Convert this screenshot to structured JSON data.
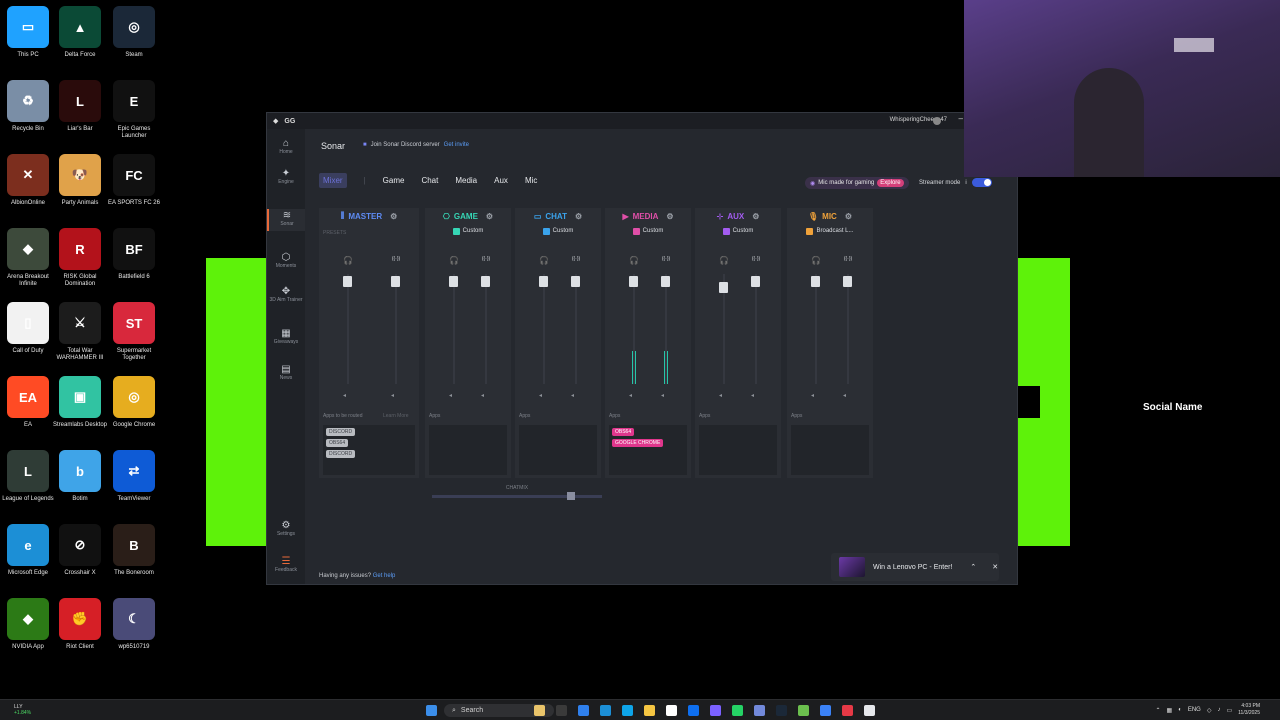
{
  "desktop": {
    "icons": [
      {
        "label": "This PC",
        "icon": "monitor-icon",
        "color": "#1fa2ff"
      },
      {
        "label": "Delta Force",
        "icon": "delta-force-icon",
        "color": "#0b4a36"
      },
      {
        "label": "Steam",
        "icon": "steam-icon",
        "color": "#1b2838"
      },
      {
        "label": "Recycle Bin",
        "icon": "recycle-bin-icon",
        "color": "#7a8ea6"
      },
      {
        "label": "Liar's Bar",
        "icon": "liars-bar-icon",
        "color": "#2a0b0b"
      },
      {
        "label": "Epic Games Launcher",
        "icon": "epic-games-icon",
        "color": "#111111"
      },
      {
        "label": "AlbionOnline",
        "icon": "albion-icon",
        "color": "#7c2e1e"
      },
      {
        "label": "Party Animals",
        "icon": "party-animals-icon",
        "color": "#e0a24a"
      },
      {
        "label": "EA SPORTS FC 26",
        "icon": "fc26-icon",
        "color": "#111111"
      },
      {
        "label": "Arena Breakout Infinite",
        "icon": "arena-breakout-icon",
        "color": "#3d4a3b"
      },
      {
        "label": "RISK Global Domination",
        "icon": "risk-icon",
        "color": "#b3121b"
      },
      {
        "label": "Battlefield 6",
        "icon": "battlefield-icon",
        "color": "#111111"
      },
      {
        "label": "Call of Duty",
        "icon": "file-icon",
        "color": "#f2f2f2"
      },
      {
        "label": "Total War WARHAMMER III",
        "icon": "warhammer-icon",
        "color": "#1c1c1c"
      },
      {
        "label": "Supermarket Together",
        "icon": "supermarket-icon",
        "color": "#d8283c"
      },
      {
        "label": "EA",
        "icon": "ea-icon",
        "color": "#ff4b24"
      },
      {
        "label": "Streamlabs Desktop",
        "icon": "streamlabs-icon",
        "color": "#31c3a2"
      },
      {
        "label": "Google Chrome",
        "icon": "chrome-icon",
        "color": "#e6ad1f"
      },
      {
        "label": "League of Legends",
        "icon": "league-icon",
        "color": "#2f3c36"
      },
      {
        "label": "Botim",
        "icon": "botim-icon",
        "color": "#3fa4e8"
      },
      {
        "label": "TeamViewer",
        "icon": "teamviewer-icon",
        "color": "#0e5bd6"
      },
      {
        "label": "Microsoft Edge",
        "icon": "edge-icon",
        "color": "#1c8fd6"
      },
      {
        "label": "Crosshair X",
        "icon": "crosshair-icon",
        "color": "#111111"
      },
      {
        "label": "The Boneroom",
        "icon": "boneroom-icon",
        "color": "#2a1e18"
      },
      {
        "label": "NVIDIA App",
        "icon": "nvidia-icon",
        "color": "#2c7a16"
      },
      {
        "label": "Riot Client",
        "icon": "riot-icon",
        "color": "#d61f26"
      },
      {
        "label": "wp6510719",
        "icon": "wallpaper-image-icon",
        "color": "#4a4b78"
      }
    ]
  },
  "sonar": {
    "title_logo": "GG",
    "username": "WhisperingCheese47",
    "sidebar": [
      {
        "label": "Home",
        "icon": "home-icon"
      },
      {
        "label": "Engine",
        "icon": "engine-icon"
      },
      {
        "label": "Sonar",
        "icon": "sonar-icon"
      },
      {
        "label": "Moments",
        "icon": "moments-icon"
      },
      {
        "label": "3D Aim Trainer",
        "icon": "aim-trainer-icon"
      },
      {
        "label": "Giveaways",
        "icon": "gift-icon"
      },
      {
        "label": "News",
        "icon": "news-icon"
      },
      {
        "label": "Settings",
        "icon": "gear-icon"
      },
      {
        "label": "Feedback",
        "icon": "feedback-icon"
      }
    ],
    "header": {
      "title": "Sonar",
      "discord_text": "Join Sonar Discord server",
      "discord_link": "Get invite"
    },
    "tabs": [
      "Mixer",
      "Game",
      "Chat",
      "Media",
      "Aux",
      "Mic"
    ],
    "promo": {
      "text": "Mic made for gaming",
      "button": "Explore"
    },
    "streamer_mode": "Streamer mode",
    "presets_label": "PRESETS",
    "channels": [
      {
        "name": "MASTER",
        "color": "#5e8cf5",
        "preset": "",
        "apps_label": "Apps to be routed",
        "learn_more": "Learn More",
        "apps": [
          "DISCORD",
          "OBS64",
          "DISCORD"
        ],
        "chip_style": "grey",
        "meter": [
          0,
          0
        ]
      },
      {
        "name": "GAME",
        "color": "#36d6b5",
        "preset": "Custom",
        "apps_label": "Apps",
        "apps": [],
        "chip_style": "grey",
        "meter": [
          0,
          0
        ]
      },
      {
        "name": "CHAT",
        "color": "#3aa3ec",
        "preset": "Custom",
        "apps_label": "Apps",
        "apps": [],
        "chip_style": "grey",
        "meter": [
          0,
          0
        ]
      },
      {
        "name": "MEDIA",
        "color": "#e04fa8",
        "preset": "Custom",
        "apps_label": "Apps",
        "apps": [
          "OBS64",
          "GOOGLE CHROME"
        ],
        "chip_style": "pink",
        "meter": [
          0.3,
          0.3
        ]
      },
      {
        "name": "AUX",
        "color": "#a35cf0",
        "preset": "Custom",
        "apps_label": "Apps",
        "apps": [],
        "chip_style": "grey",
        "meter": [
          0,
          0
        ]
      },
      {
        "name": "MIC",
        "color": "#f0a23a",
        "preset": "Broadcast L...",
        "apps_label": "Apps",
        "apps": [],
        "chip_style": "grey",
        "meter": [
          0,
          0
        ]
      }
    ],
    "chatmix_label": "CHATMIX",
    "issues": {
      "text": "Having any issues?",
      "link": "Get help"
    },
    "toast": {
      "text": "Win a Lenovo PC - Enter!"
    }
  },
  "overlay": {
    "social_name": "Social Name"
  },
  "taskbar": {
    "stock": {
      "ticker": "LLY",
      "change": "+1.84%"
    },
    "search": "Search",
    "tray": {
      "lang": "ENG",
      "time": "4:03 PM",
      "date": "11/3/2025"
    }
  }
}
